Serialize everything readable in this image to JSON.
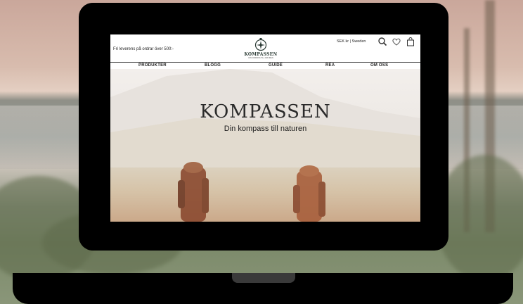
{
  "topbar": {
    "shipping_text": "Fri leverens på ordrar över 500:-",
    "currency_text": "SEK kr | Sweden"
  },
  "logo": {
    "name": "KOMPASSEN",
    "tagline": "DIN KOMPASS TILL NATUREN"
  },
  "nav": {
    "items": [
      "PRODUKTER",
      "BLOGG",
      "GUIDE",
      "REA",
      "OM OSS"
    ]
  },
  "hero": {
    "title": "KOMPASSEN",
    "subtitle": "Din kompass till naturen"
  },
  "icons": {
    "search": "search-icon",
    "wishlist": "heart-icon",
    "cart": "bag-icon"
  },
  "colors": {
    "laptop": "#000000",
    "logo_green": "#2a3a34"
  }
}
